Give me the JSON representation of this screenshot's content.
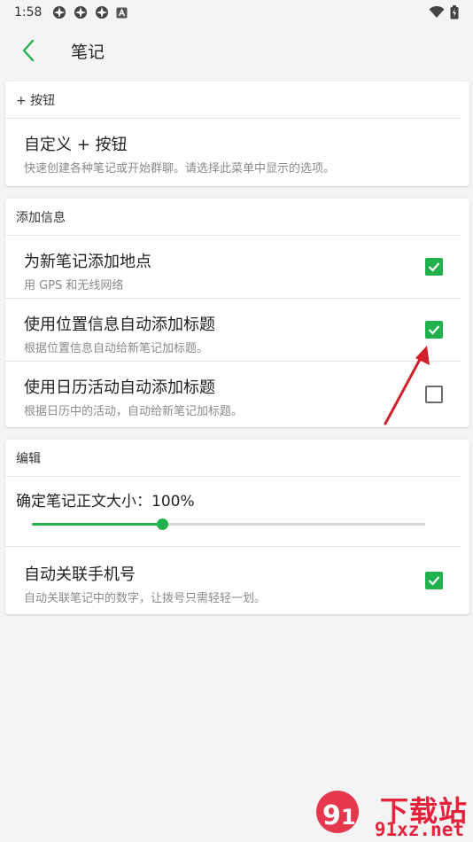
{
  "status_bar": {
    "time": "1:58",
    "icons": [
      "app-icon",
      "app-icon",
      "app-icon",
      "a-icon"
    ],
    "right_icons": [
      "wifi-icon",
      "battery-icon"
    ]
  },
  "header": {
    "title": "笔记"
  },
  "sections": {
    "button": {
      "header": "+ 按钮",
      "items": [
        {
          "title": "自定义 + 按钮",
          "subtitle": "快速创建各种笔记或开始群聊。请选择此菜单中显示的选项。"
        }
      ]
    },
    "add_info": {
      "header": "添加信息",
      "items": [
        {
          "title": "为新笔记添加地点",
          "subtitle": "用 GPS 和无线网络",
          "checked": true
        },
        {
          "title": "使用位置信息自动添加标题",
          "subtitle": "根据位置信息自动给新笔记加标题。",
          "checked": true
        },
        {
          "title": "使用日历活动自动添加标题",
          "subtitle": "根据日历中的活动，自动给新笔记加标题。",
          "checked": false
        }
      ]
    },
    "edit": {
      "header": "编辑",
      "font_size_label": "确定笔记正文大小：100%",
      "font_size_fraction": 0.33,
      "items": [
        {
          "title": "自动关联手机号",
          "subtitle": "自动关联笔记中的数字，让拨号只需轻轻一划。",
          "checked": true
        }
      ]
    }
  },
  "watermark": {
    "text": "下载站",
    "url": "91xz.net"
  },
  "colors": {
    "accent": "#20b14c",
    "annotation_arrow": "#d0202a",
    "watermark": "#e3223b"
  }
}
